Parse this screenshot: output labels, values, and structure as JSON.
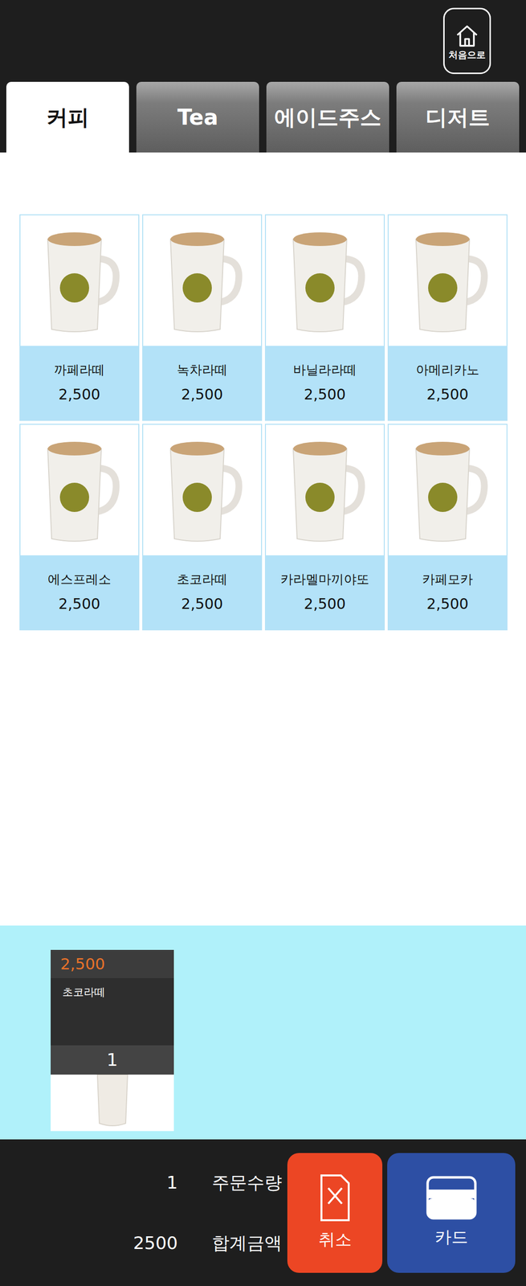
{
  "header": {
    "home_label": "처음으로"
  },
  "tabs": [
    {
      "label": "커피",
      "selected": true
    },
    {
      "label": "Tea",
      "selected": false
    },
    {
      "label": "에이드주스",
      "selected": false
    },
    {
      "label": "디저트",
      "selected": false
    }
  ],
  "products": [
    {
      "name": "까페라떼",
      "price": "2,500"
    },
    {
      "name": "녹차라떼",
      "price": "2,500"
    },
    {
      "name": "바닐라라떼",
      "price": "2,500"
    },
    {
      "name": "아메리카노",
      "price": "2,500"
    },
    {
      "name": "에스프레소",
      "price": "2,500"
    },
    {
      "name": "초코라떼",
      "price": "2,500"
    },
    {
      "name": "카라멜마끼야또",
      "price": "2,500"
    },
    {
      "name": "카페모카",
      "price": "2,500"
    }
  ],
  "cart": [
    {
      "price": "2,500",
      "name": "초코라떼",
      "quantity": "1"
    }
  ],
  "summary": {
    "quantity": "1",
    "quantity_label": "주문수량",
    "total": "2500",
    "total_label": "합계금액"
  },
  "buttons": [
    {
      "label": "취소",
      "kind": "cancel"
    },
    {
      "label": "카드",
      "kind": "card"
    }
  ]
}
